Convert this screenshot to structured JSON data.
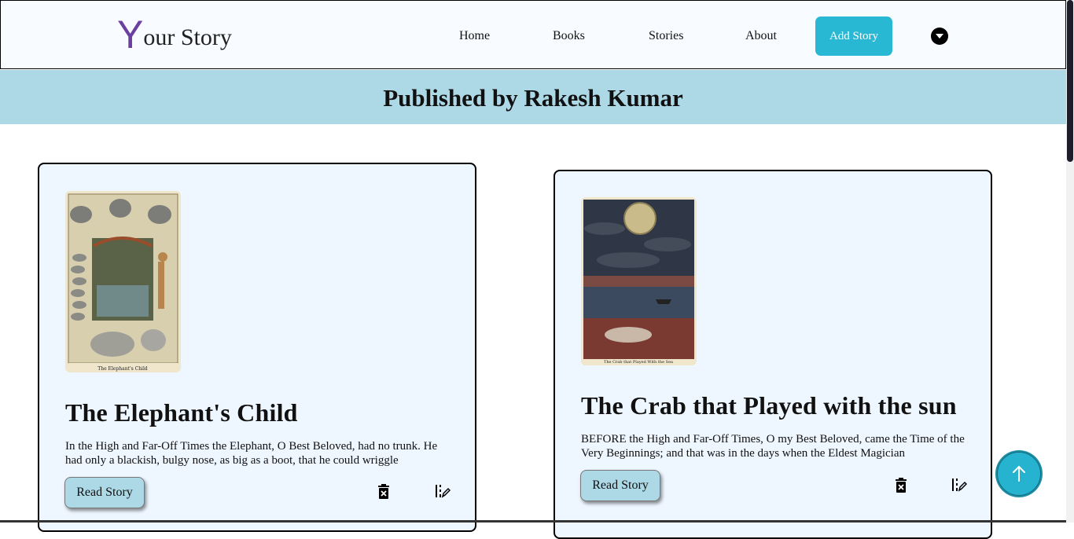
{
  "nav": {
    "logo_initial": "Y",
    "logo_rest": "our Story",
    "links": [
      "Home",
      "Books",
      "Stories",
      "About"
    ],
    "add_story": "Add Story"
  },
  "banner": {
    "title": "Published by Rakesh Kumar"
  },
  "cards": [
    {
      "title": "The Elephant's Child",
      "excerpt": "In the High and Far-Off Times the Elephant, O Best Beloved, had no trunk. He had only a blackish, bulgy nose, as big as a boot, that he could wriggle",
      "cover_caption": "The Elephant's Child",
      "read_label": "Read Story"
    },
    {
      "title": "The Crab that Played with the sun",
      "excerpt": "BEFORE the High and Far-Off Times, O my Best Beloved, came the Time of the Very Beginnings; and that was in the days when the Eldest Magician",
      "cover_caption": "The Crab that Played With the Sea",
      "read_label": "Read Story"
    }
  ]
}
